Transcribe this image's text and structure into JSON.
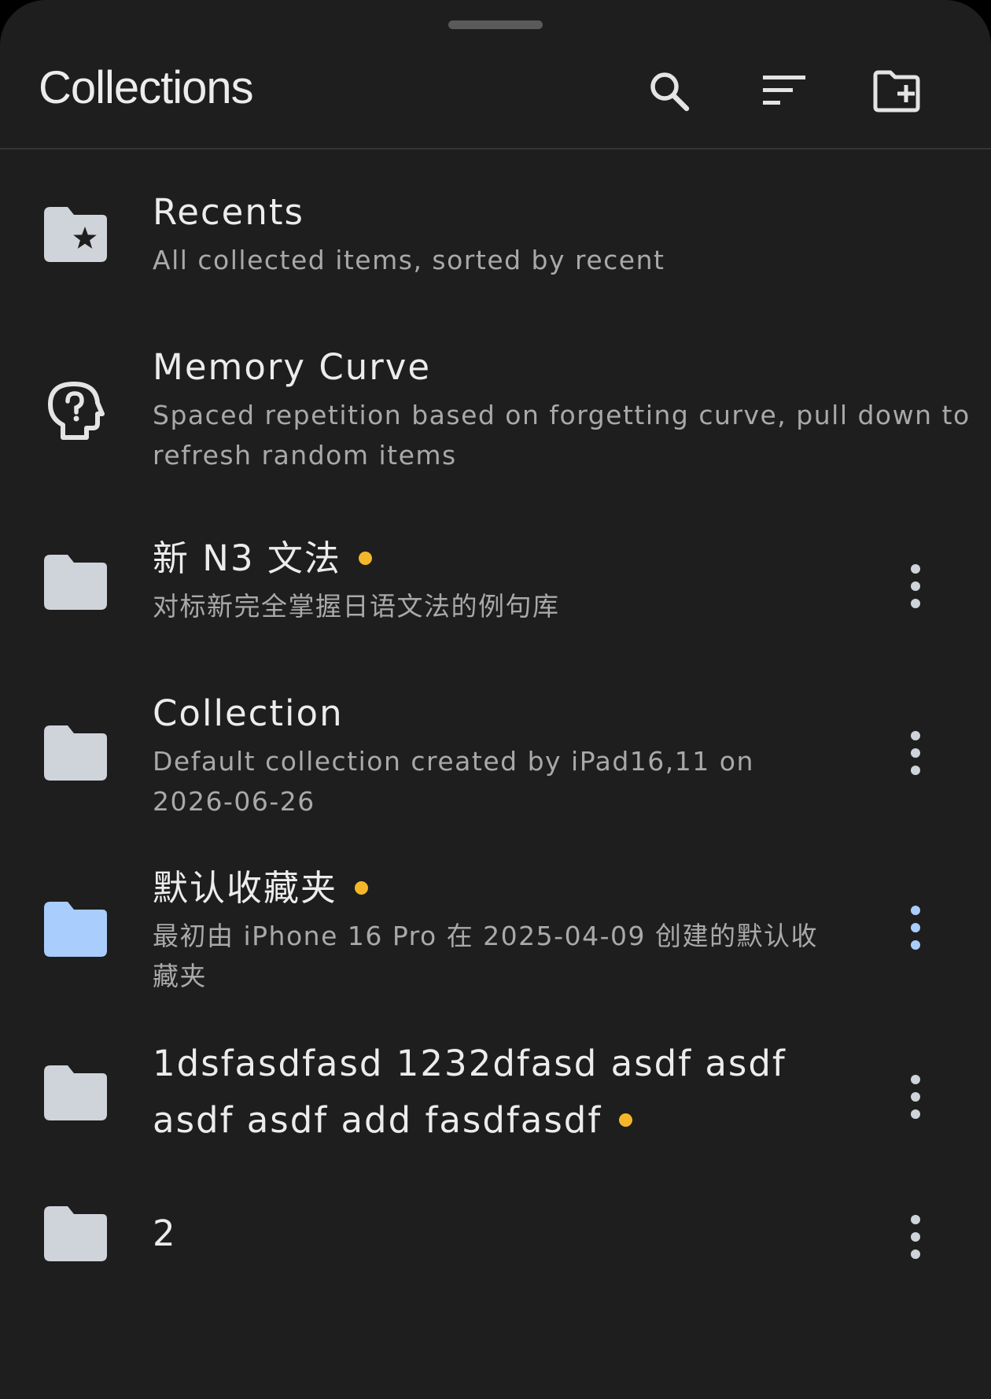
{
  "header": {
    "title": "Collections",
    "icons": [
      "search-icon",
      "sort-icon",
      "create-folder-icon"
    ]
  },
  "colors": {
    "background": "#1e1e1e",
    "text_primary": "#ececec",
    "text_secondary": "#a9a9a9",
    "folder_default": "#cfd3da",
    "folder_selected": "#a9cdfd",
    "badge_dot": "#f5b72a"
  },
  "collections": [
    {
      "title": "Recents",
      "subtitle": "All collected items, sorted by recent",
      "icon": "folder-star-icon",
      "has_menu": false,
      "unread_dot": false
    },
    {
      "title": "Memory Curve",
      "subtitle": "Spaced repetition based on forgetting curve, pull down to refresh random items",
      "icon": "head-question-icon",
      "has_menu": false,
      "unread_dot": false
    },
    {
      "title": "新 N3 文法",
      "subtitle": "对标新完全掌握日语文法的例句库",
      "icon": "folder-icon",
      "has_menu": true,
      "unread_dot": true
    },
    {
      "title": "Collection",
      "subtitle": "Default collection created by iPad16,11 on 2026-06-26",
      "icon": "folder-icon",
      "has_menu": true,
      "unread_dot": false
    },
    {
      "title": "默认收藏夹",
      "subtitle": "最初由 iPhone 16 Pro 在 2025-04-09 创建的默认收藏夹",
      "icon": "folder-icon",
      "has_menu": true,
      "unread_dot": true,
      "selected": true
    },
    {
      "title": "1dsfasdfasd 1232dfasd asdf asdf asdf asdf add fasdfasdf",
      "subtitle": "",
      "icon": "folder-icon",
      "has_menu": true,
      "unread_dot": true
    },
    {
      "title": "2",
      "subtitle": "",
      "icon": "folder-icon",
      "has_menu": true,
      "unread_dot": false
    }
  ]
}
